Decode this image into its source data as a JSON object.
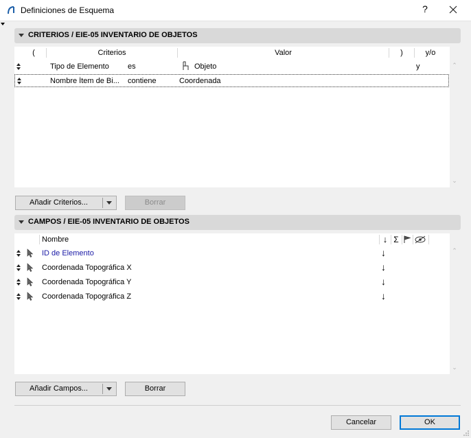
{
  "window": {
    "title": "Definiciones de Esquema",
    "help_label": "?"
  },
  "criteria": {
    "header": "CRITERIOS / EIE-05 INVENTARIO DE OBJETOS",
    "columns": {
      "open_paren": "(",
      "criteria": "Criterios",
      "value": "Valor",
      "close_paren": ")",
      "and_or": "y/o"
    },
    "rows": [
      {
        "paren_open": "",
        "criterion": "Tipo de Elemento",
        "operator": "es",
        "value_icon": "chair-icon",
        "value": "Objeto",
        "paren_close": "",
        "and_or": "y"
      },
      {
        "paren_open": "",
        "criterion": "Nombre Ítem de Bi...",
        "operator": "contiene",
        "value_icon": "",
        "value": "Coordenada",
        "paren_close": "",
        "and_or": ""
      }
    ],
    "add_button": "Añadir Criterios...",
    "delete_button": "Borrar"
  },
  "fields": {
    "header": "CAMPOS / EIE-05 INVENTARIO DE OBJETOS",
    "columns": {
      "name": "Nombre"
    },
    "rows": [
      {
        "name": "ID de Elemento",
        "highlight": true,
        "sort": "↓"
      },
      {
        "name": "Coordenada Topográfica X",
        "highlight": false,
        "sort": "↓"
      },
      {
        "name": "Coordenada Topográfica Y",
        "highlight": false,
        "sort": "↓"
      },
      {
        "name": "Coordenada Topográfica Z",
        "highlight": false,
        "sort": "↓"
      }
    ],
    "column_icons": {
      "sort": "↓",
      "sum": "Σ"
    },
    "add_button": "Añadir Campos...",
    "delete_button": "Borrar"
  },
  "footer": {
    "cancel_button": "Cancelar",
    "ok_button": "OK"
  },
  "colors": {
    "link_blue": "#1a1aa6",
    "ok_border": "#0078d7"
  }
}
